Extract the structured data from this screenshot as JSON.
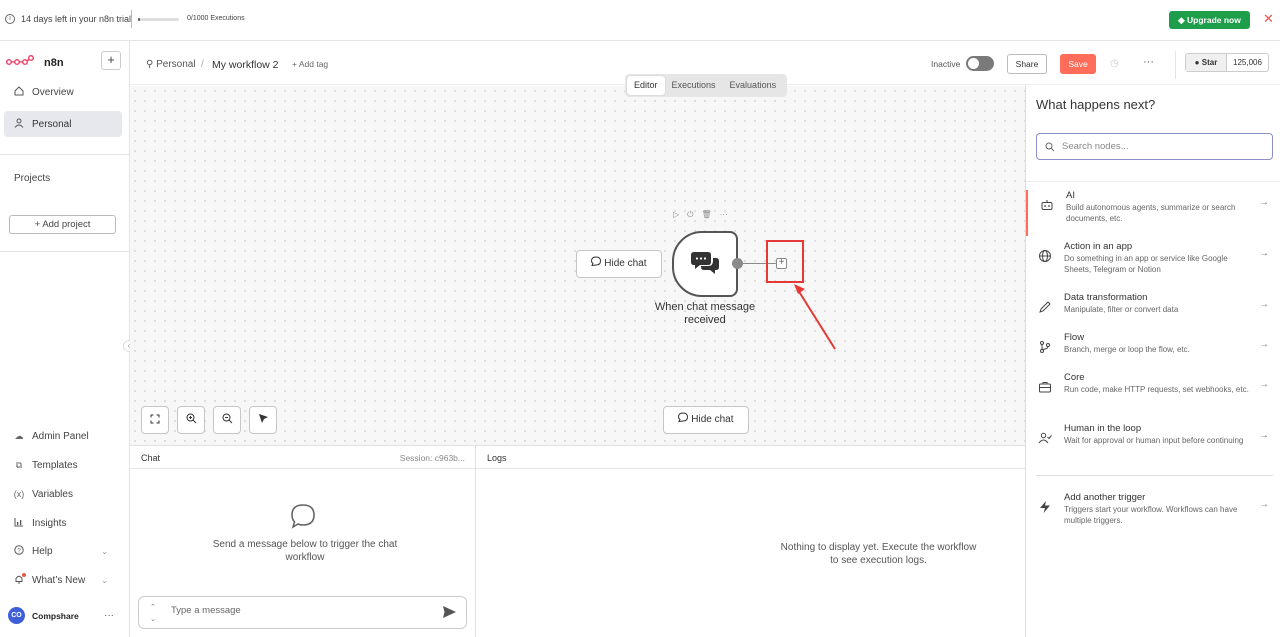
{
  "trial": {
    "text": "14 days left in your n8n trial",
    "executions": "0/1000 Executions",
    "executions_fraction": 0.0,
    "upgrade_label": "Upgrade now"
  },
  "sidebar": {
    "brand": "n8n",
    "items": [
      {
        "label": "Overview",
        "icon": "home-icon"
      },
      {
        "label": "Personal",
        "icon": "user-icon"
      }
    ],
    "projects_label": "Projects",
    "add_project_label": "Add project",
    "bottom_items": [
      {
        "label": "Admin Panel",
        "icon": "cloud-icon"
      },
      {
        "label": "Templates",
        "icon": "box-icon"
      },
      {
        "label": "Variables",
        "icon": "variables-icon"
      },
      {
        "label": "Insights",
        "icon": "chart-icon"
      },
      {
        "label": "Help",
        "icon": "help-icon"
      },
      {
        "label": "What’s New",
        "icon": "bell-icon"
      }
    ],
    "user": {
      "initials": "CO",
      "name": "Compshare"
    }
  },
  "header": {
    "breadcrumb_project": "Personal",
    "breadcrumb_sep": "/",
    "workflow_name": "My workflow 2",
    "add_tag": "+ Add tag",
    "status_label": "Inactive",
    "share_label": "Share",
    "save_label": "Save",
    "github_star": "Star",
    "github_count": "125,006"
  },
  "tabs": [
    "Editor",
    "Executions",
    "Evaluations"
  ],
  "canvas": {
    "hide_chat_label": "Hide chat",
    "node_label": "When chat message received",
    "hide_chat_bottom_label": "Hide chat"
  },
  "chat": {
    "title": "Chat",
    "session": "Session: c963b...",
    "empty_text": "Send a message below to trigger the chat workflow",
    "input_placeholder": "Type a message"
  },
  "logs": {
    "title": "Logs",
    "empty_text": "Nothing to display yet. Execute the workflow to see execution logs."
  },
  "next_panel": {
    "title": "What happens next?",
    "search_placeholder": "Search nodes...",
    "items": [
      {
        "name": "AI",
        "desc": "Build autonomous agents, summarize or search documents, etc.",
        "icon": "robot-icon"
      },
      {
        "name": "Action in an app",
        "desc": "Do something in an app or service like Google Sheets, Telegram or Notion",
        "icon": "globe-icon"
      },
      {
        "name": "Data transformation",
        "desc": "Manipulate, filter or convert data",
        "icon": "pen-icon"
      },
      {
        "name": "Flow",
        "desc": "Branch, merge or loop the flow, etc.",
        "icon": "branch-icon"
      },
      {
        "name": "Core",
        "desc": "Run code, make HTTP requests, set webhooks, etc.",
        "icon": "toolbox-icon"
      },
      {
        "name": "Human in the loop",
        "desc": "Wait for approval or human input before continuing",
        "icon": "user-check-icon"
      }
    ],
    "trigger": {
      "name": "Add another trigger",
      "desc": "Triggers start your workflow. Workflows can have multiple triggers.",
      "icon": "bolt-icon"
    }
  },
  "colors": {
    "accent": "#ff6d5a",
    "upgrade": "#1e9e4a",
    "annotation": "#e53935"
  }
}
